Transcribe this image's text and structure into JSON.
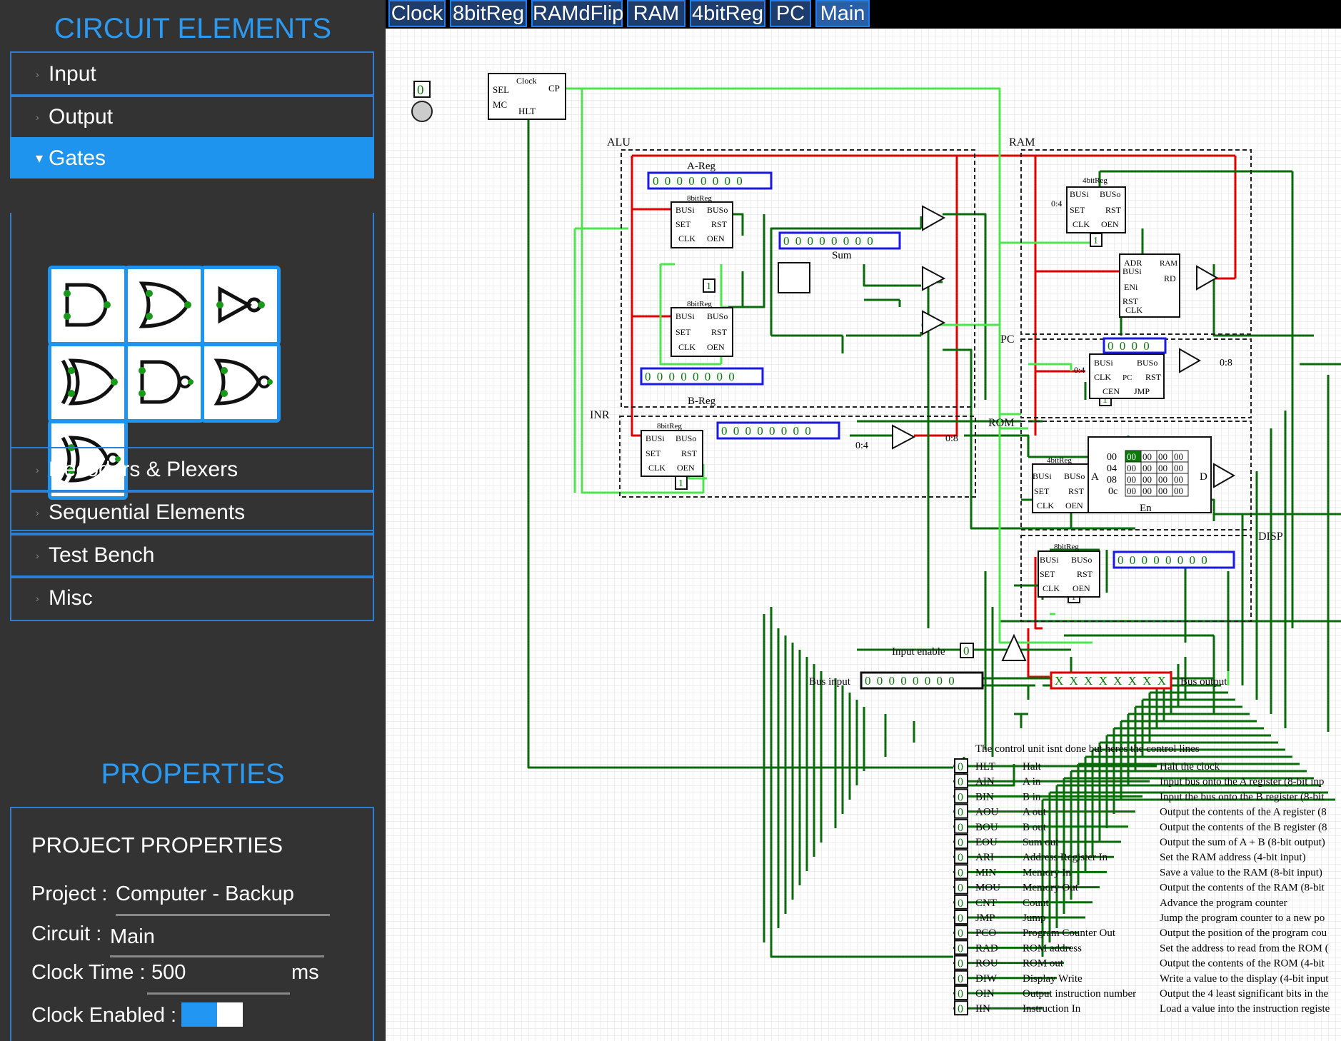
{
  "sidebar": {
    "title": "CIRCUIT ELEMENTS",
    "categories": [
      "Input",
      "Output",
      "Gates",
      "Decoders & Plexers",
      "Sequential Elements",
      "Test Bench",
      "Misc"
    ],
    "gate_icons": [
      "and-gate-icon",
      "or-gate-icon",
      "not-gate-icon",
      "xor-gate-icon",
      "nand-gate-icon",
      "nor-gate-icon",
      "xnor-gate-icon"
    ],
    "properties_title": "PROPERTIES",
    "project_properties": {
      "heading": "PROJECT PROPERTIES",
      "project_label": "Project :",
      "project_value": "Computer - Backup",
      "circuit_label": "Circuit :",
      "circuit_value": "Main",
      "clock_label": "Clock Time :",
      "clock_value": "500",
      "clock_unit": "ms",
      "clock_enabled_label": "Clock Enabled :",
      "clock_enabled": true
    }
  },
  "tabs": [
    "Clock",
    "8bitReg",
    "RAMdFlip",
    "RAM",
    "4bitReg",
    "PC",
    "Main"
  ],
  "active_tab": "Main",
  "canvas": {
    "section_labels": [
      "ALU",
      "RAM",
      "INR",
      "PC",
      "ROM",
      "DISP"
    ],
    "clock": {
      "title": "Clock",
      "pins": [
        "SEL",
        "MC",
        "CP",
        "HLT"
      ],
      "input_value": "0"
    },
    "a_reg": {
      "label": "A-Reg",
      "value": "0 0 0 0 0 0 0 0",
      "type": "8bitReg"
    },
    "b_reg": {
      "label": "B-Reg",
      "value": "0 0 0 0 0 0 0 0",
      "type": "8bitReg"
    },
    "sum": {
      "label": "Sum",
      "value": "0 0 0 0 0 0 0 0"
    },
    "inr": {
      "type": "8bitReg",
      "value": "0 0 0 0 0 0 0 0",
      "split_labels": [
        "0:4",
        "0:8"
      ]
    },
    "ram_block": {
      "reg_type": "4bitReg",
      "ram_pins": [
        "ADR",
        "BUSi",
        "ENi",
        "RST",
        "CLK",
        "RAM",
        "RD"
      ],
      "split": "0:4",
      "const": "1"
    },
    "pc": {
      "value": "0 0 0 0",
      "pins": [
        "BUSi",
        "BUSo",
        "CLK",
        "PC",
        "RST",
        "CEN",
        "JMP"
      ],
      "split_labels": [
        "0:4",
        "0:8"
      ]
    },
    "rom": {
      "reg_type": "4bitReg",
      "rows": [
        "00",
        "04",
        "08",
        "0c"
      ],
      "cells": "00",
      "pins": [
        "A",
        "D",
        "En"
      ]
    },
    "disp": {
      "type": "8bitReg",
      "value": "0 0 0 0 0 0 0 0"
    },
    "reg_pins": [
      "BUSi",
      "BUSo",
      "SET",
      "RST",
      "CLK",
      "OEN"
    ],
    "input_enable": {
      "label": "Input enable",
      "value": "0"
    },
    "bus_input": {
      "label": "Bus input",
      "value": "0 0 0 0 0 0 0 0"
    },
    "bus_output": {
      "label": "Bus output",
      "value": "X X X X X X X X"
    },
    "control_header": "The control unit isnt done but heres the control lines",
    "control_lines": [
      {
        "code": "HLT",
        "name": "Halt",
        "desc": "Halt the clock"
      },
      {
        "code": "AIN",
        "name": "A in",
        "desc": "Input bus onto the A register (8-bit inp"
      },
      {
        "code": "BIN",
        "name": "B in",
        "desc": "Input the bus onto the B register (8-bit"
      },
      {
        "code": "AOU",
        "name": "A out",
        "desc": "Output the contents of the A register (8"
      },
      {
        "code": "BOU",
        "name": "B out",
        "desc": "Output the contents of the B register (8"
      },
      {
        "code": "EOU",
        "name": "Sum out",
        "desc": "Output the sum of A + B (8-bit output)"
      },
      {
        "code": "ARI",
        "name": "Address Register In",
        "desc": "Set the RAM address (4-bit input)"
      },
      {
        "code": "MIN",
        "name": "Memory In",
        "desc": "Save a value to the RAM (8-bit input)"
      },
      {
        "code": "MOU",
        "name": "Memory Out",
        "desc": "Output the contents of the RAM (8-bit"
      },
      {
        "code": "CNT",
        "name": "Count",
        "desc": "Advance the program counter"
      },
      {
        "code": "JMP",
        "name": "Jump",
        "desc": "Jump the program counter to a new po"
      },
      {
        "code": "PCO",
        "name": "Program Counter Out",
        "desc": "Output the position of the program cou"
      },
      {
        "code": "RAD",
        "name": "ROM address",
        "desc": "Set the address to read from the ROM ("
      },
      {
        "code": "ROU",
        "name": "ROM out",
        "desc": "Output the contents of the ROM (4-bit"
      },
      {
        "code": "DIW",
        "name": "Display Write",
        "desc": "Write a value to the display (4-bit input"
      },
      {
        "code": "OIN",
        "name": "Output instruction number",
        "desc": "Output the 4 least significant bits in the"
      },
      {
        "code": "IIN",
        "name": "Instruction In",
        "desc": "Load a value into the instruction registe"
      }
    ],
    "control_value": "0",
    "colors": {
      "wire_low": "#0a6b0a",
      "wire_high": "#e00000",
      "wire_bright": "#4ee44e",
      "display_border": "#1a1ae0",
      "bus_out_border": "#e00000",
      "accent": "#1f94ee"
    }
  }
}
